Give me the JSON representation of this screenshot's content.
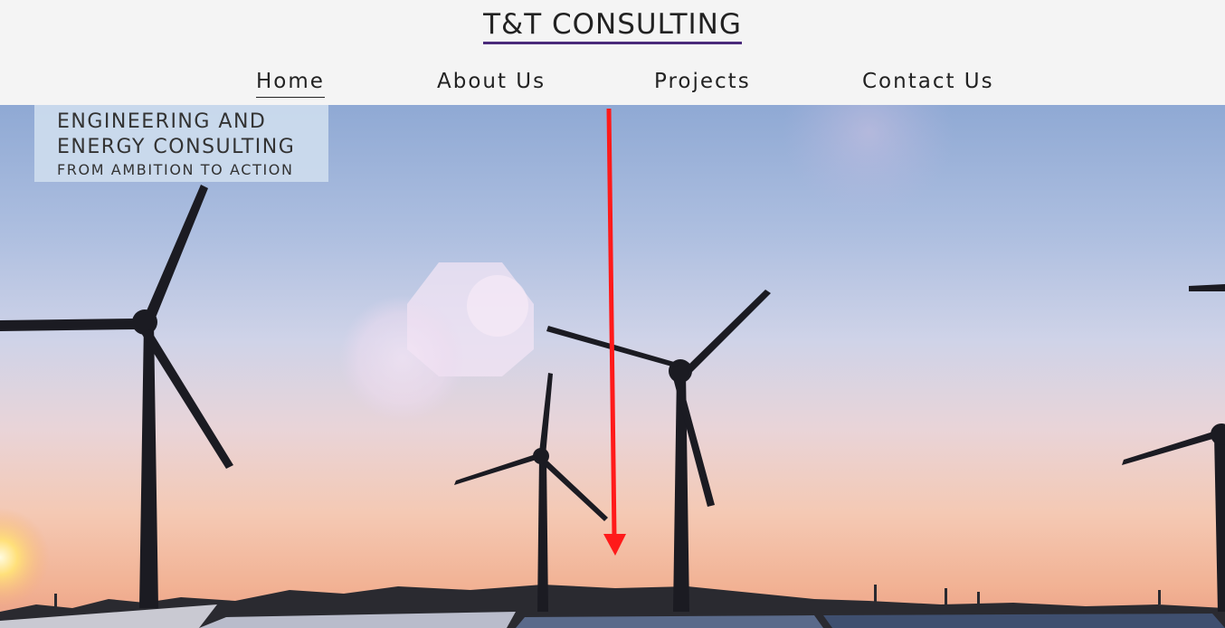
{
  "header": {
    "brand": "T&T CONSULTING",
    "nav": [
      {
        "label": "Home",
        "active": true
      },
      {
        "label": "About Us",
        "active": false
      },
      {
        "label": "Projects",
        "active": false
      },
      {
        "label": "Contact Us",
        "active": false
      }
    ]
  },
  "hero": {
    "tagline_line1": "ENGINEERING AND",
    "tagline_line2": "ENERGY CONSULTING",
    "tagline_line3": "FROM AMBITION TO ACTION",
    "image_subject": "wind turbines and solar panels at sunset"
  },
  "colors": {
    "brand_underline": "#4a2a7a",
    "annotation_arrow": "#ff1a1a",
    "header_bg": "#f4f4f4"
  }
}
